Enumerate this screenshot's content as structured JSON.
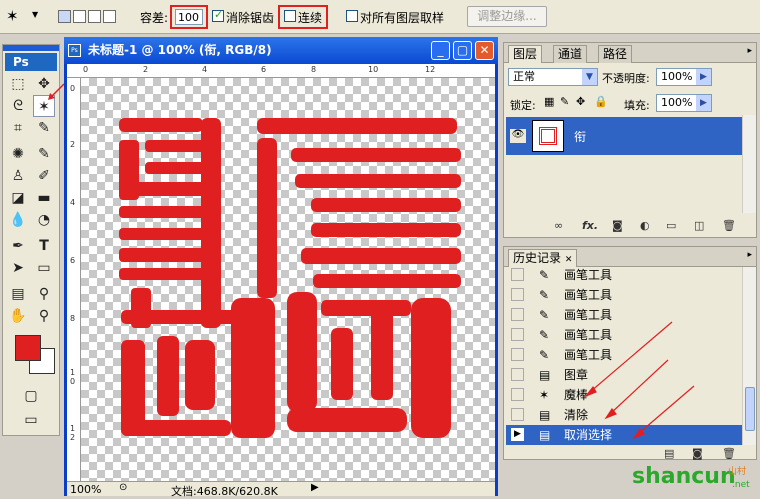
{
  "options_bar": {
    "tolerance_label": "容差:",
    "tolerance_value": "100",
    "antialias_label": "消除锯齿",
    "antialias_checked": true,
    "contiguous_label": "连续",
    "contiguous_checked": false,
    "sample_all_label": "对所有图层取样",
    "sample_all_checked": false,
    "refine_edge_label": "调整边缘..."
  },
  "toolbox": {
    "logo": "Ps"
  },
  "document": {
    "title": "未标题-1 @ 100% (衔, RGB/8)",
    "ruler_h": [
      "0",
      "2",
      "4",
      "6",
      "8",
      "10",
      "12"
    ],
    "ruler_v": [
      "0",
      "2",
      "4",
      "6",
      "8",
      "1\n0",
      "1\n2"
    ],
    "zoom": "100%",
    "doc_info": "文档:468.8K/620.8K",
    "seal_color": "#e02020"
  },
  "layers_panel": {
    "tabs": [
      "图层",
      "通道",
      "路径"
    ],
    "blend_mode": "正常",
    "opacity_label": "不透明度:",
    "opacity_value": "100%",
    "lock_label": "锁定:",
    "fill_label": "填充:",
    "fill_value": "100%",
    "layers": [
      {
        "name": "衔",
        "visible": true,
        "selected": true
      }
    ]
  },
  "history_panel": {
    "title": "历史记录",
    "items": [
      {
        "label": "画笔工具",
        "icon": "brush-icon"
      },
      {
        "label": "画笔工具",
        "icon": "brush-icon"
      },
      {
        "label": "画笔工具",
        "icon": "brush-icon"
      },
      {
        "label": "画笔工具",
        "icon": "brush-icon"
      },
      {
        "label": "画笔工具",
        "icon": "brush-icon"
      },
      {
        "label": "图章",
        "icon": "stamp-icon"
      },
      {
        "label": "魔棒",
        "icon": "magic-wand-icon"
      },
      {
        "label": "清除",
        "icon": "clear-icon"
      },
      {
        "label": "取消选择",
        "icon": "deselect-icon",
        "active": true
      }
    ]
  },
  "watermark": {
    "text": "shancun",
    "sub": "山村",
    "domain": ".net"
  },
  "colors": {
    "accent": "#e02020",
    "title_blue": "#0a49d2",
    "selection": "#2f63c4"
  }
}
